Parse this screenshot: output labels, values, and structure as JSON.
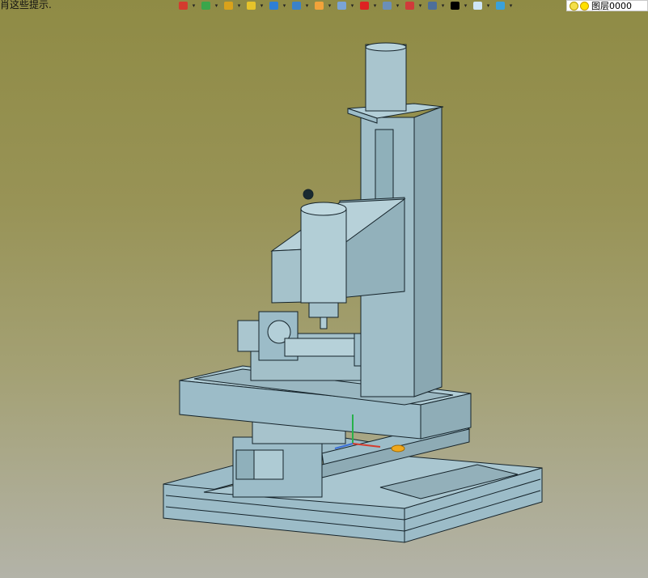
{
  "hint": {
    "text": "肖这些提示."
  },
  "toolbar": {
    "buttons": [
      {
        "name": "new-icon",
        "color": "#d33b2e"
      },
      {
        "name": "move-icon",
        "color": "#3aa64b"
      },
      {
        "name": "pencil-icon",
        "color": "#d9a21b"
      },
      {
        "name": "box-yellow-icon",
        "color": "#e6c32a"
      },
      {
        "name": "cube-blue-icon",
        "color": "#2f7fd6"
      },
      {
        "name": "cube-view-icon",
        "color": "#3b82c9"
      },
      {
        "name": "render-wheel-icon",
        "color": "#f2a33a"
      },
      {
        "name": "display-icon",
        "color": "#7aa4d6"
      },
      {
        "name": "axis-icon",
        "color": "#d22"
      },
      {
        "name": "section-icon",
        "color": "#6b8fb8"
      },
      {
        "name": "frame-icon",
        "color": "#d03a3a"
      },
      {
        "name": "monitor-icon",
        "color": "#4d6f9a"
      },
      {
        "name": "line-style-icon",
        "color": "#000000"
      },
      {
        "name": "color-icon",
        "color": "#cfe6f7"
      },
      {
        "name": "layer-stack-icon",
        "color": "#3aa1d9"
      }
    ]
  },
  "layer": {
    "label": "图层0000"
  },
  "model": {
    "part_color": "#9cbcc8",
    "edge_color": "#15232a"
  }
}
